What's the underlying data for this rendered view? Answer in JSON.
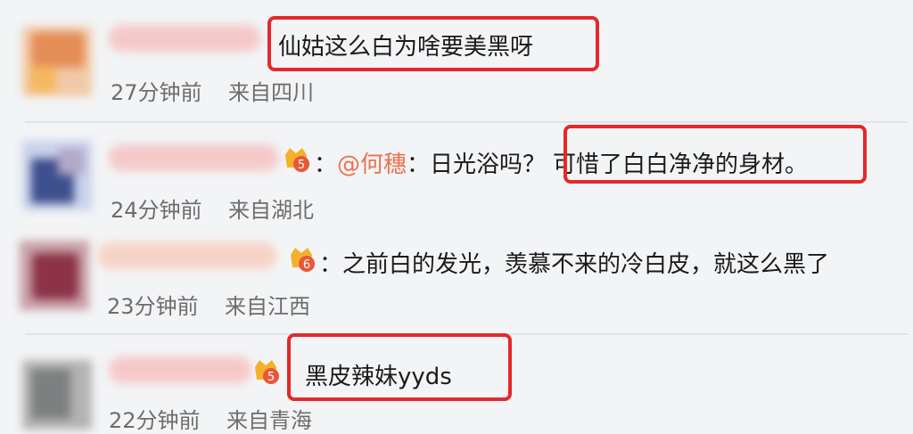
{
  "comments": [
    {
      "text": "仙姑这么白为啥要美黑呀",
      "time": "27分钟前",
      "location": "来自四川"
    },
    {
      "colon": "：",
      "mention": "@何穗",
      "prefix": "：日光浴吗？",
      "highlight": "可惜了白白净净的身材。",
      "badge": "5",
      "time": "24分钟前",
      "location": "来自湖北"
    },
    {
      "colon": "：",
      "text": "之前白的发光，羡慕不来的冷白皮，就这么黑了",
      "badge": "6",
      "time": "23分钟前",
      "location": "来自江西"
    },
    {
      "text": "黑皮辣妹yyds",
      "badge": "5",
      "time": "22分钟前",
      "location": "来自青海"
    }
  ],
  "colors": {
    "highlight_box": "#e5282b",
    "mention": "#eb7350",
    "badge_gold": "#f6b12b",
    "badge_red": "#e8573a"
  }
}
